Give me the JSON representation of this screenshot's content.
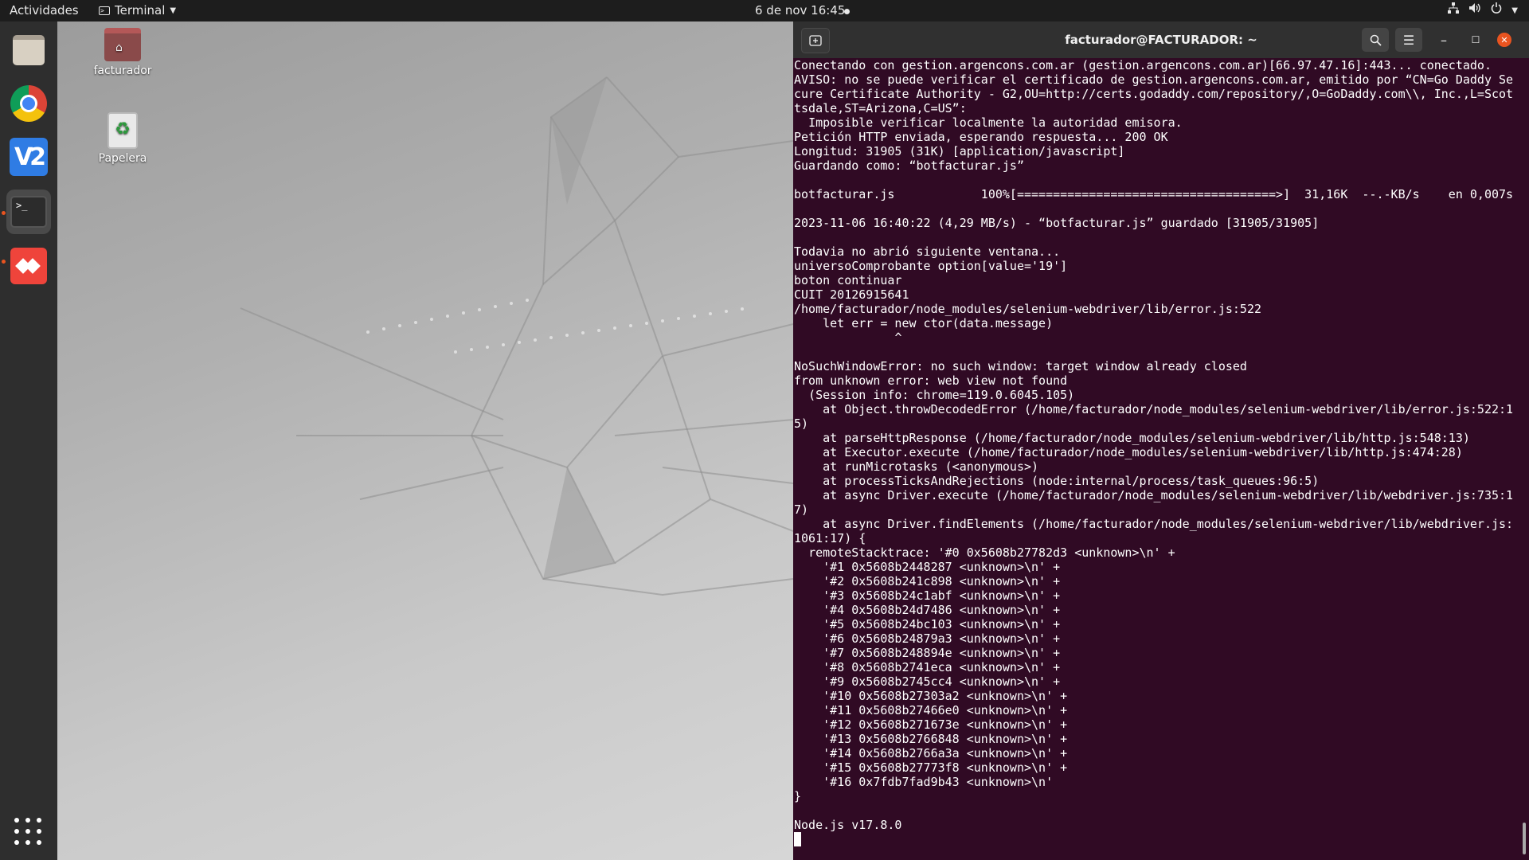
{
  "topbar": {
    "activities": "Actividades",
    "app_menu": "Terminal",
    "clock": "6 de nov  16:45",
    "tray_icons": [
      "network-icon",
      "volume-icon",
      "power-icon",
      "chevron-down-icon"
    ]
  },
  "dock": {
    "items": [
      "files",
      "chrome",
      "vnc-viewer",
      "terminal",
      "anydesk"
    ],
    "vnc_label": "V2",
    "terminal_prompt": ">_"
  },
  "desktop": {
    "icons": [
      {
        "label": "facturador",
        "type": "home-folder"
      },
      {
        "label": "Papelera",
        "type": "trash"
      }
    ]
  },
  "terminal": {
    "title": "facturador@FACTURADOR: ~",
    "accent": "#e95420",
    "background": "#300a24",
    "output": "Conectando con gestion.argencons.com.ar (gestion.argencons.com.ar)[66.97.47.16]:443... conectado.\nAVISO: no se puede verificar el certificado de gestion.argencons.com.ar, emitido por “CN=Go Daddy Secure Certificate Authority - G2,OU=http://certs.godaddy.com/repository/,O=GoDaddy.com\\\\, Inc.,L=Scottsdale,ST=Arizona,C=US”:\n  Imposible verificar localmente la autoridad emisora.\nPetición HTTP enviada, esperando respuesta... 200 OK\nLongitud: 31905 (31K) [application/javascript]\nGuardando como: “botfacturar.js”\n\nbotfacturar.js            100%[====================================>]  31,16K  --.-KB/s    en 0,007s\n\n2023-11-06 16:40:22 (4,29 MB/s) - “botfacturar.js” guardado [31905/31905]\n\nTodavia no abrió siguiente ventana...\nuniversoComprobante option[value='19']\nboton continuar\nCUIT 20126915641\n/home/facturador/node_modules/selenium-webdriver/lib/error.js:522\n    let err = new ctor(data.message)\n              ^\n\nNoSuchWindowError: no such window: target window already closed\nfrom unknown error: web view not found\n  (Session info: chrome=119.0.6045.105)\n    at Object.throwDecodedError (/home/facturador/node_modules/selenium-webdriver/lib/error.js:522:15)\n    at parseHttpResponse (/home/facturador/node_modules/selenium-webdriver/lib/http.js:548:13)\n    at Executor.execute (/home/facturador/node_modules/selenium-webdriver/lib/http.js:474:28)\n    at runMicrotasks (<anonymous>)\n    at processTicksAndRejections (node:internal/process/task_queues:96:5)\n    at async Driver.execute (/home/facturador/node_modules/selenium-webdriver/lib/webdriver.js:735:17)\n    at async Driver.findElements (/home/facturador/node_modules/selenium-webdriver/lib/webdriver.js:1061:17) {\n  remoteStacktrace: '#0 0x5608b27782d3 <unknown>\\n' +\n    '#1 0x5608b2448287 <unknown>\\n' +\n    '#2 0x5608b241c898 <unknown>\\n' +\n    '#3 0x5608b24c1abf <unknown>\\n' +\n    '#4 0x5608b24d7486 <unknown>\\n' +\n    '#5 0x5608b24bc103 <unknown>\\n' +\n    '#6 0x5608b24879a3 <unknown>\\n' +\n    '#7 0x5608b248894e <unknown>\\n' +\n    '#8 0x5608b2741eca <unknown>\\n' +\n    '#9 0x5608b2745cc4 <unknown>\\n' +\n    '#10 0x5608b27303a2 <unknown>\\n' +\n    '#11 0x5608b27466e0 <unknown>\\n' +\n    '#12 0x5608b271673e <unknown>\\n' +\n    '#13 0x5608b2766848 <unknown>\\n' +\n    '#14 0x5608b2766a3a <unknown>\\n' +\n    '#15 0x5608b27773f8 <unknown>\\n' +\n    '#16 0x7fdb7fad9b43 <unknown>\\n'\n}\n\nNode.js v17.8.0\n"
  }
}
